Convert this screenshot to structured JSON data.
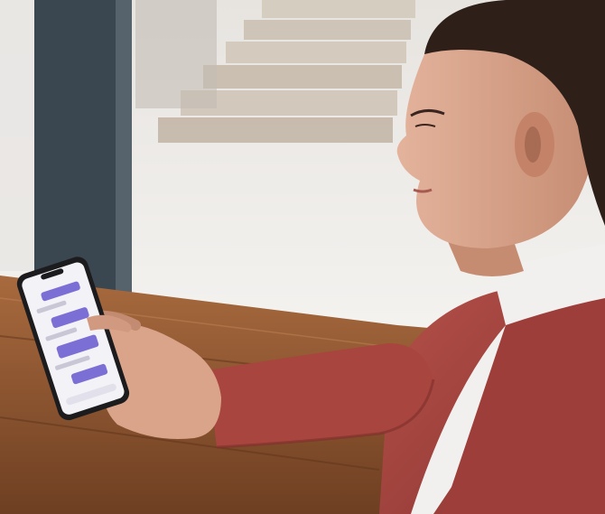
{
  "scene": {
    "colors": {
      "window_light": "#f4f2ef",
      "steps": "#d8cfc4",
      "frame": "#3a4650",
      "table": "#9a5f36",
      "skin": "#d9a48a",
      "hair": "#2e1f19",
      "jacket": "#a8453f",
      "turtleneck": "#f1f0ee",
      "phone": "#1c1c1e",
      "screen": "#f3f2f7",
      "bubble": "#7b6fd6"
    }
  }
}
